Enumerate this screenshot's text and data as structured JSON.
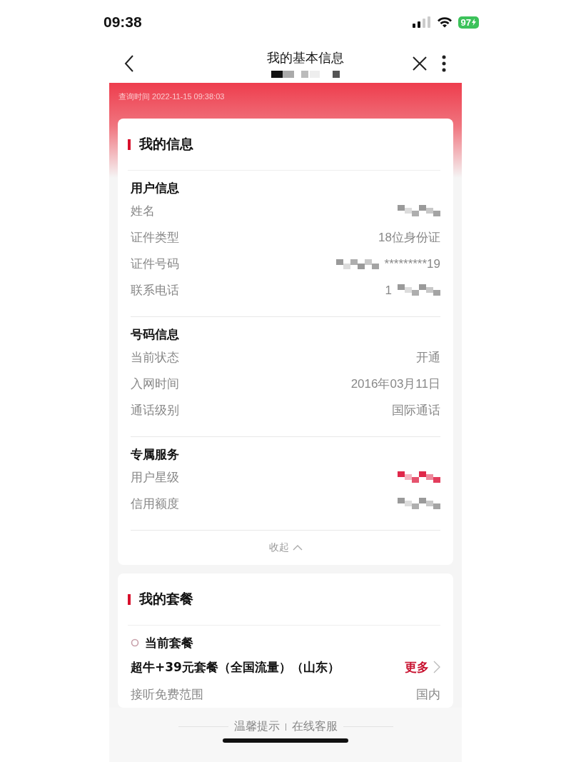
{
  "status_bar": {
    "time": "09:38",
    "battery": "97"
  },
  "nav": {
    "title": "我的基本信息",
    "subtitle_masked": true
  },
  "query_time": "查询时间 2022-11-15 09:38:03",
  "info_card": {
    "title": "我的信息",
    "groups": [
      {
        "title": "用户信息",
        "rows": [
          {
            "label": "姓名",
            "masked_after": true,
            "color": "#9a9a9a"
          },
          {
            "label": "证件类型",
            "value": "18位身份证"
          },
          {
            "label": "证件号码",
            "value": "*********19",
            "masked_before": true,
            "color": "#9a9a9a"
          },
          {
            "label": "联系电话",
            "value": "1",
            "masked_after": true,
            "color": "#9a9a9a"
          }
        ]
      },
      {
        "title": "号码信息",
        "rows": [
          {
            "label": "当前状态",
            "value": "开通"
          },
          {
            "label": "入网时间",
            "value": "2016年03月11日"
          },
          {
            "label": "通话级别",
            "value": "国际通话"
          }
        ]
      },
      {
        "title": "专属服务",
        "rows": [
          {
            "label": "用户星级",
            "masked_after": true,
            "color": "#e0284a"
          },
          {
            "label": "信用额度",
            "masked_after": true,
            "color": "#9a9a9a"
          }
        ]
      }
    ],
    "collapse": "收起"
  },
  "plan_card": {
    "title": "我的套餐",
    "section": "当前套餐",
    "plan_name": "超牛+39元套餐（全国流量）（山东）",
    "more": "更多",
    "rows": [
      {
        "label": "接听免费范围",
        "value": "国内"
      }
    ]
  },
  "footer": {
    "links": [
      "温馨提示",
      "在线客服"
    ]
  }
}
